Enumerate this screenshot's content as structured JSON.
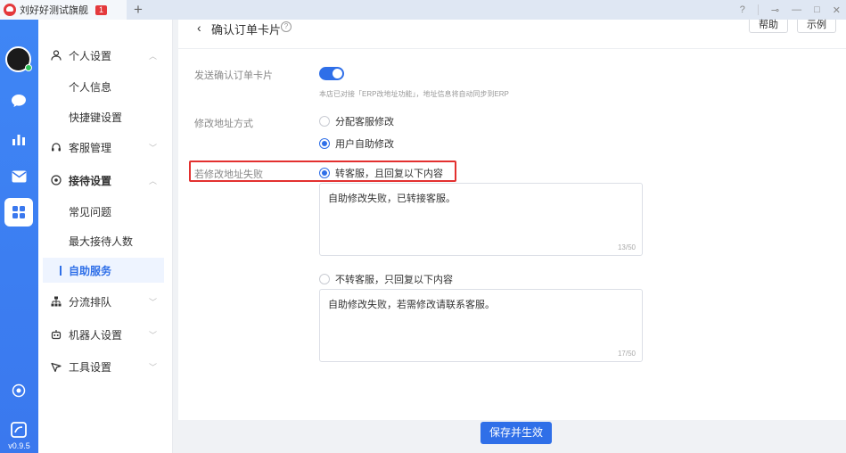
{
  "tab": {
    "title": "刘好好测试旗舰",
    "badge": "1"
  },
  "window": {
    "add_tab": "+",
    "help": "?",
    "pin": "⊸",
    "minimize": "—",
    "maximize": "□",
    "close": "✕"
  },
  "rail": {
    "version": "v0.9.5"
  },
  "menu": {
    "personal_settings": "个人设置",
    "personal_info": "个人信息",
    "shortcut_settings": "快捷键设置",
    "service_management": "客服管理",
    "reception_settings": "接待设置",
    "faq": "常见问题",
    "max_reception": "最大接待人数",
    "self_service": "自助服务",
    "routing_queue": "分流排队",
    "robot_settings": "机器人设置",
    "tool_settings": "工具设置"
  },
  "header": {
    "title": "确认订单卡片",
    "help_btn": "帮助",
    "example_btn": "示例"
  },
  "form": {
    "send_card_label": "发送确认订单卡片",
    "send_card_enabled": true,
    "erp_hint": "本店已对接「ERP改地址功能」，地址信息将自动同步到ERP",
    "modify_method_label": "修改地址方式",
    "option_assign": "分配客服修改",
    "option_self": "用户自助修改",
    "fail_label": "若修改地址失败",
    "option_transfer": "转客服，且回复以下内容",
    "transfer_text": "自助修改失败，已转接客服。",
    "transfer_count": "13/50",
    "option_no_transfer": "不转客服，只回复以下内容",
    "no_transfer_text": "自助修改失败，若需修改请联系客服。",
    "no_transfer_count": "17/50"
  },
  "footer": {
    "save": "保存并生效"
  },
  "colors": {
    "accent": "#2f6fe8",
    "highlight": "#e3302f",
    "rail": "#3a78ee"
  }
}
